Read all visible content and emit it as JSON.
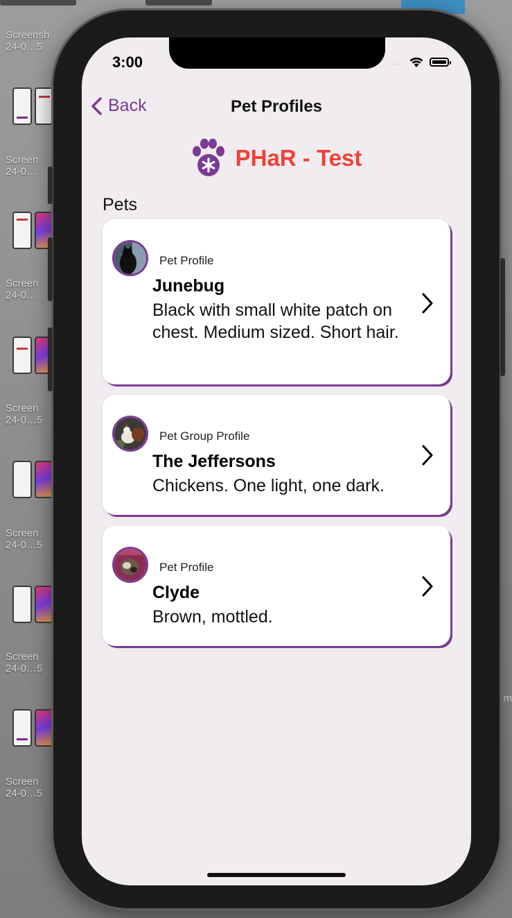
{
  "desktop": {
    "labels": [
      "Screensh\n24-0…5",
      "Screen\n24-0…",
      "Screen\n24-0…",
      "Screen\n24-0…5",
      "Screen\n24-0…5",
      "Screen\n24-0…5",
      "Screen\n24-0…5"
    ],
    "right_edge_text": "m"
  },
  "status_bar": {
    "time": "3:00",
    "signal": "....",
    "icons": [
      "wifi-icon",
      "battery-icon"
    ]
  },
  "nav": {
    "back_label": "Back",
    "title": "Pet Profiles"
  },
  "brand": {
    "icon": "paw-icon",
    "name": "PHaR - Test",
    "color": "#f0413a"
  },
  "pets": {
    "section_label": "Pets",
    "items": [
      {
        "kind": "Pet Profile",
        "name": "Junebug",
        "description": "Black with small white patch on chest. Medium sized. Short hair."
      },
      {
        "kind": "Pet Group Profile",
        "name": "The Jeffersons",
        "description": "Chickens. One light, one dark."
      },
      {
        "kind": "Pet Profile",
        "name": "Clyde",
        "description": "Brown, mottled."
      }
    ]
  },
  "colors": {
    "accent": "#7b3a94",
    "background": "#f1ecf0"
  }
}
